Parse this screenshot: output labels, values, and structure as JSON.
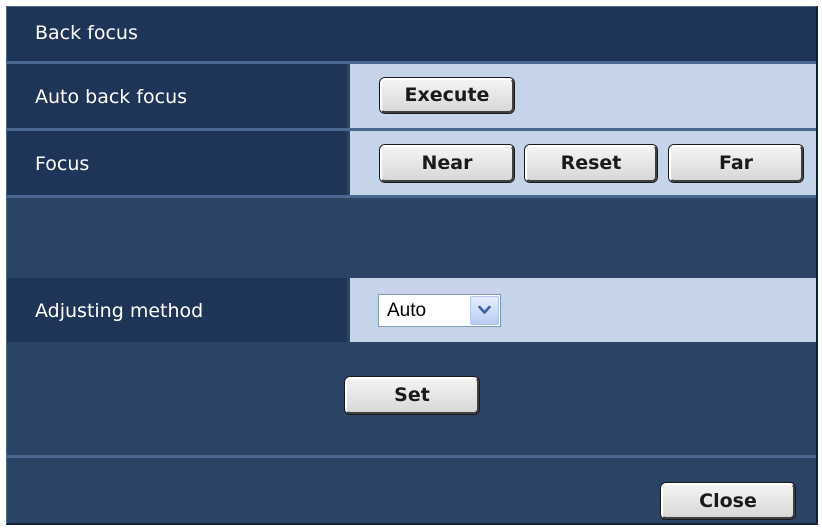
{
  "dialog": {
    "title": "Back focus"
  },
  "rows": {
    "auto_back_focus": {
      "label": "Auto back focus",
      "execute_label": "Execute"
    },
    "focus": {
      "label": "Focus",
      "near_label": "Near",
      "reset_label": "Reset",
      "far_label": "Far"
    },
    "adjusting_method": {
      "label": "Adjusting method",
      "selected_value": "Auto"
    }
  },
  "actions": {
    "set_label": "Set",
    "close_label": "Close"
  },
  "colors": {
    "panel_background": "#2b4466",
    "label_cell": "#1e3558",
    "field_cell": "#c6d4ea",
    "separator": "#4a6890"
  },
  "icons": {
    "select_arrow": "chevron-down-icon"
  }
}
